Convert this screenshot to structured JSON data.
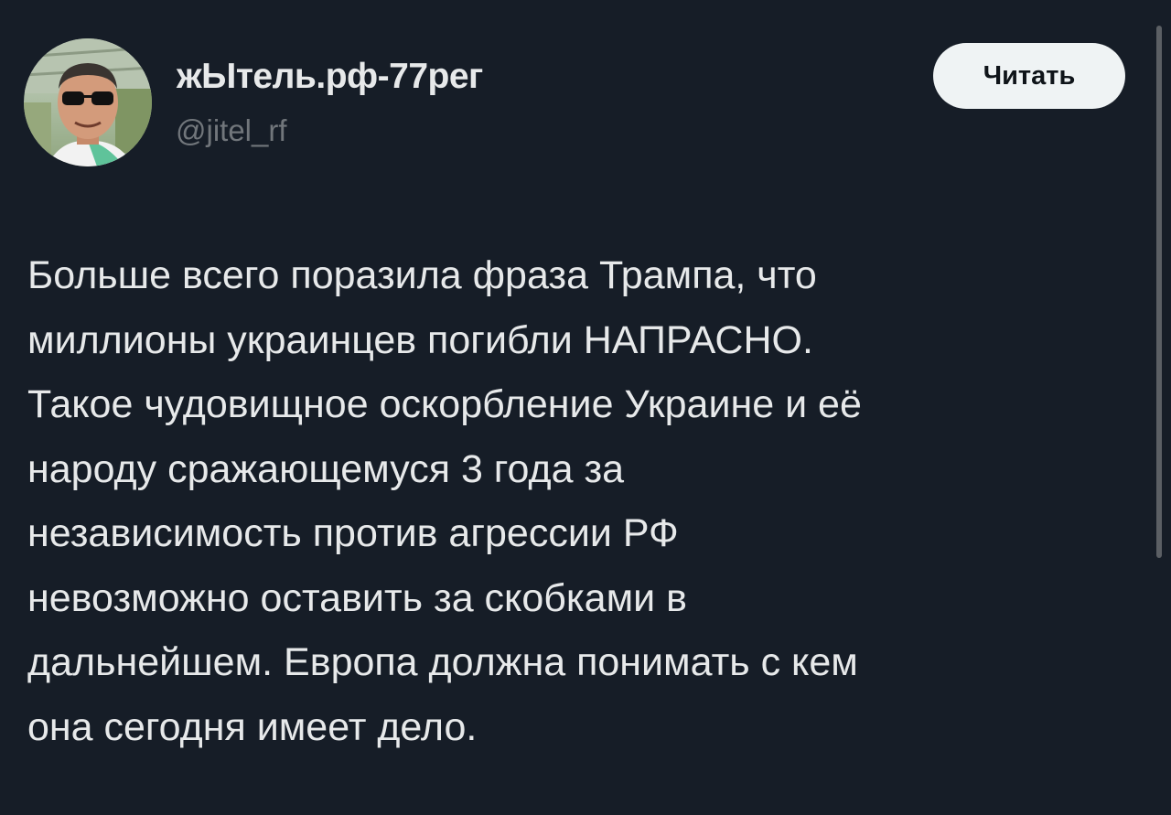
{
  "author": {
    "display_name": "жЫтель.рф-77рег",
    "handle": "@jitel_rf",
    "avatar_icon": "profile-photo"
  },
  "follow_button": {
    "label": "Читать"
  },
  "post": {
    "text": "Больше всего поразила фраза Трампа, что\nмиллионы украинцев погибли НАПРАСНО.\nТакое чудовищное оскорбление Украине и её\nнароду сражающемуся 3 года за\nнезависимость против агрессии РФ\nневозможно оставить за скобками в\nдальнейшем. Европа должна понимать с кем\nона сегодня имеет дело."
  },
  "colors": {
    "background": "#161d27",
    "primary_text": "#e7e9ea",
    "secondary_text": "#71767b",
    "button_background": "#eff3f4",
    "button_text": "#0f1419"
  }
}
